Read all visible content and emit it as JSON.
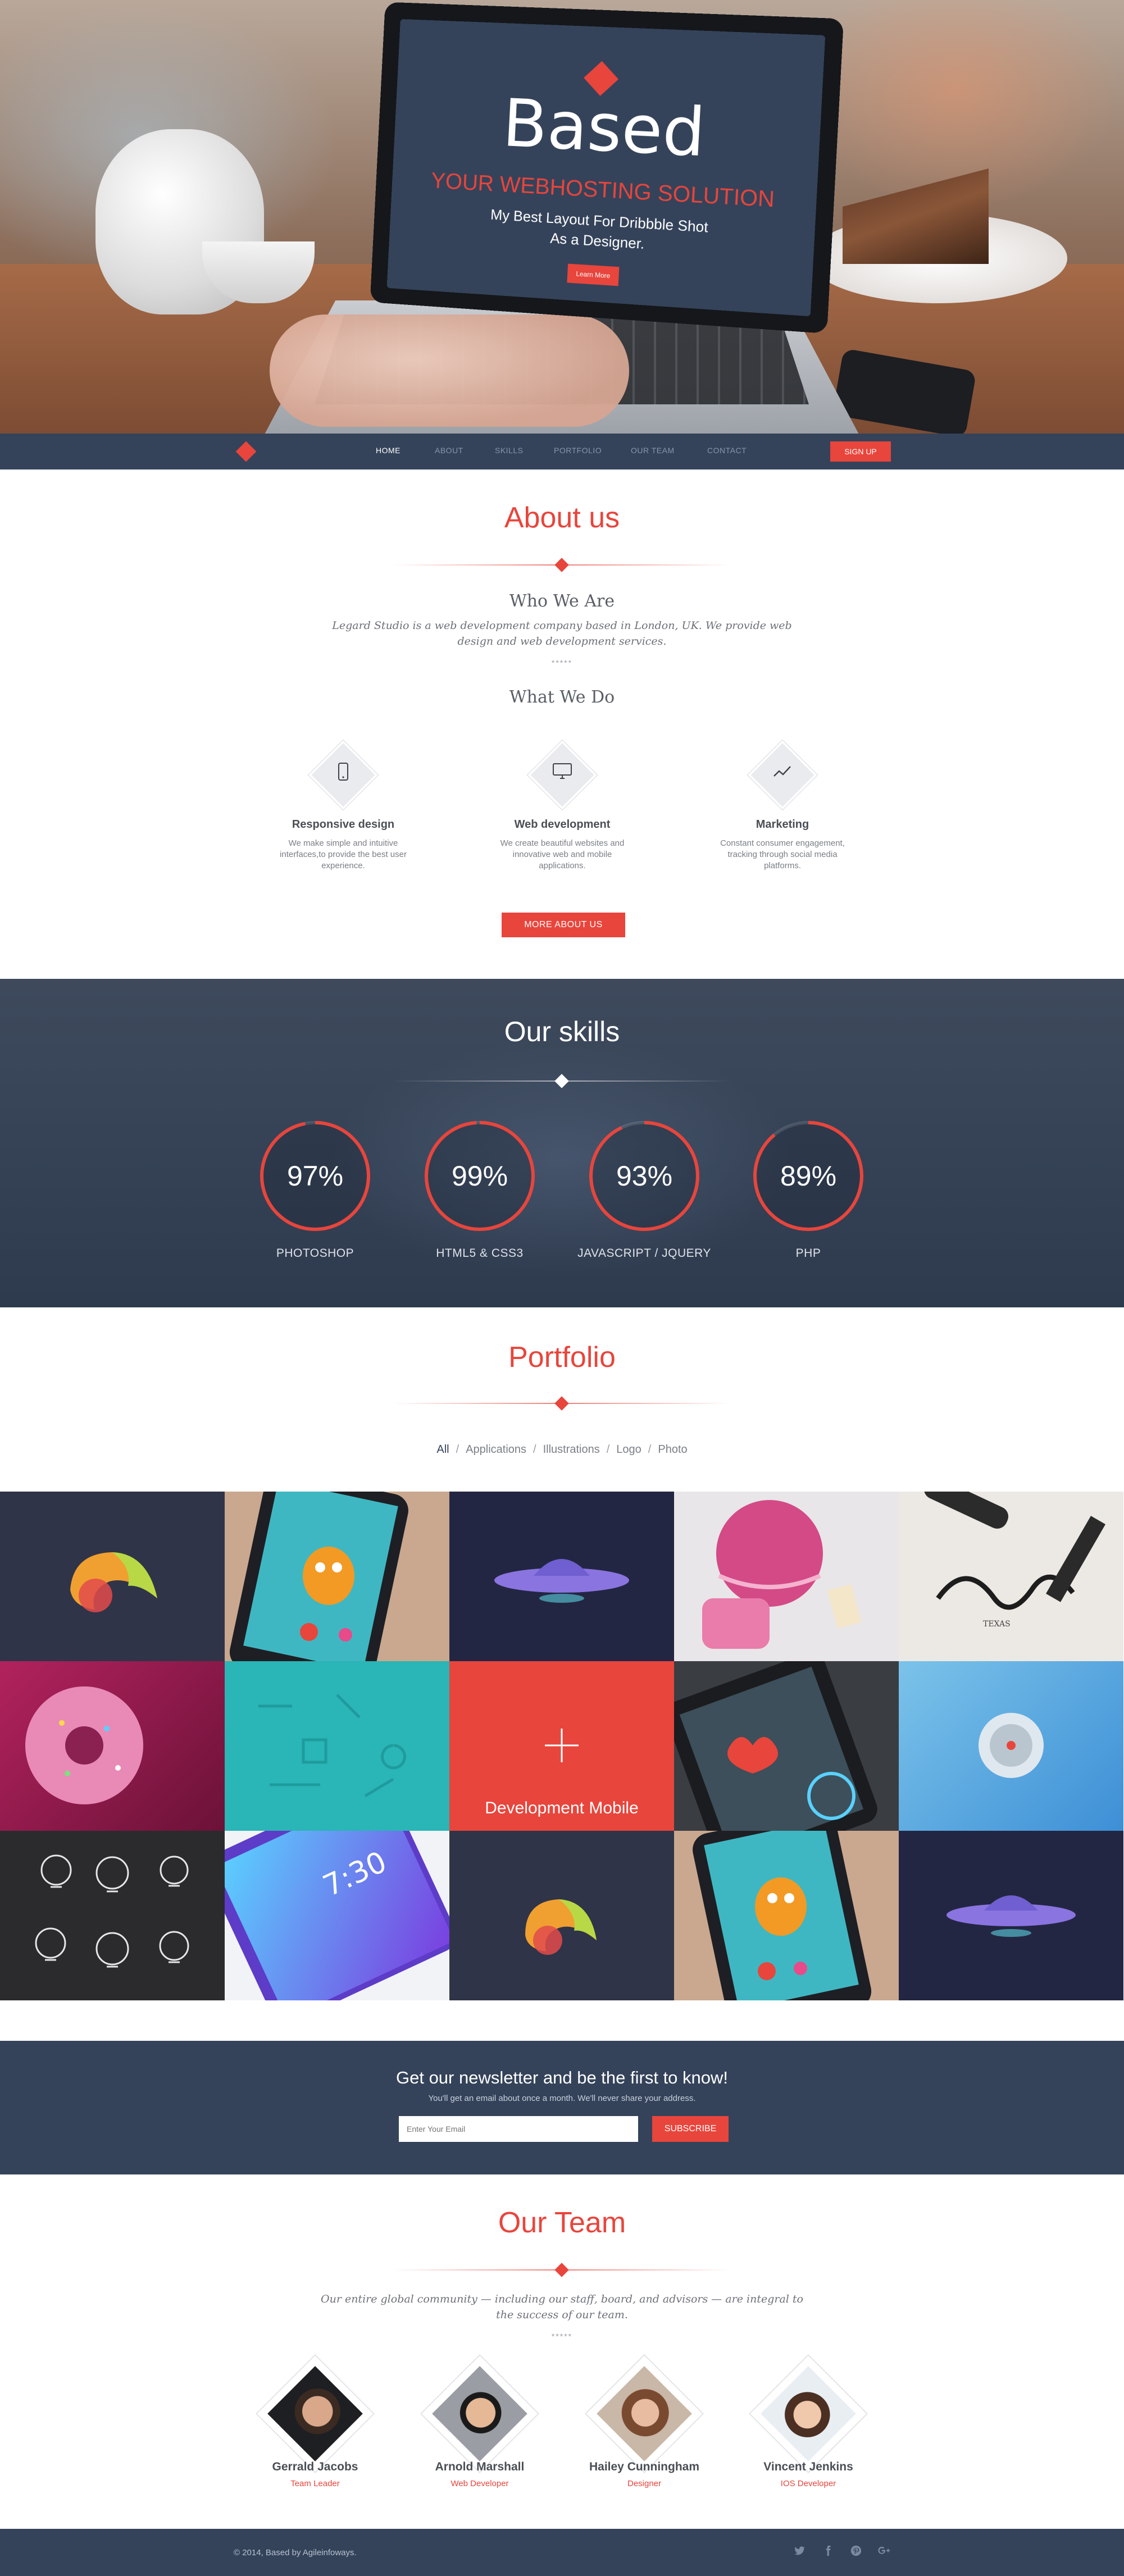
{
  "hero": {
    "brand": "Based",
    "tagline": "YOUR WEBHOSTING SOLUTION",
    "subtitle_line1": "My Best Layout For Dribbble Shot",
    "subtitle_line2": "As a Designer.",
    "button_label": "Learn More"
  },
  "nav": {
    "items": [
      "HOME",
      "ABOUT",
      "SKILLS",
      "PORTFOLIO",
      "OUR TEAM",
      "CONTACT"
    ],
    "active": "HOME",
    "signup_label": "SIGN UP"
  },
  "about": {
    "title": "About us",
    "subtitle": "Who We Are",
    "description": "Legard Studio is a web development company based in London, UK. We provide web design and web development services.",
    "stars": "*****",
    "what_we_do": "What We Do",
    "services": [
      {
        "icon": "smartphone-icon",
        "title": "Responsive design",
        "description": "We make simple and intuitive interfaces,to provide the best user experience."
      },
      {
        "icon": "monitor-icon",
        "title": "Web development",
        "description": "We create beautiful websites and innovative web and mobile applications."
      },
      {
        "icon": "line-chart-icon",
        "title": "Marketing",
        "description": "Constant consumer engagement, tracking through social media platforms."
      }
    ],
    "button_label": "MORE ABOUT US"
  },
  "skills": {
    "title": "Our skills",
    "items": [
      {
        "percent": "97%",
        "value": 97,
        "label": "PHOTOSHOP"
      },
      {
        "percent": "99%",
        "value": 99,
        "label": "HTML5 & CSS3"
      },
      {
        "percent": "93%",
        "value": 93,
        "label": "JAVASCRIPT / JQUERY"
      },
      {
        "percent": "89%",
        "value": 89,
        "label": "PHP"
      }
    ]
  },
  "portfolio": {
    "title": "Portfolio",
    "filters": [
      "All",
      "Applications",
      "Illustrations",
      "Logo",
      "Photo"
    ],
    "active_filter": "All",
    "hover_label": "Development Mobile"
  },
  "newsletter": {
    "title": "Get our newsletter and be the first to know!",
    "subtitle": "You'll get an email about once a month. We'll never share your address.",
    "placeholder": "Enter Your Email",
    "button_label": "SUBSCRIBE"
  },
  "team": {
    "title": "Our Team",
    "description": "Our entire global community — including our staff, board, and advisors — are integral to the success of our team.",
    "stars": "*****",
    "members": [
      {
        "name": "Gerrald Jacobs",
        "role": "Team Leader"
      },
      {
        "name": "Arnold Marshall",
        "role": "Web Developer"
      },
      {
        "name": "Hailey Cunningham",
        "role": "Designer"
      },
      {
        "name": "Vincent Jenkins",
        "role": "IOS Developer"
      }
    ]
  },
  "footer": {
    "copyright": "© 2014, Based by Agileinfoways.",
    "social": [
      "twitter-icon",
      "facebook-icon",
      "pinterest-icon",
      "google-plus-icon"
    ]
  },
  "colors": {
    "accent": "#e8453c",
    "navy": "#34435a"
  }
}
